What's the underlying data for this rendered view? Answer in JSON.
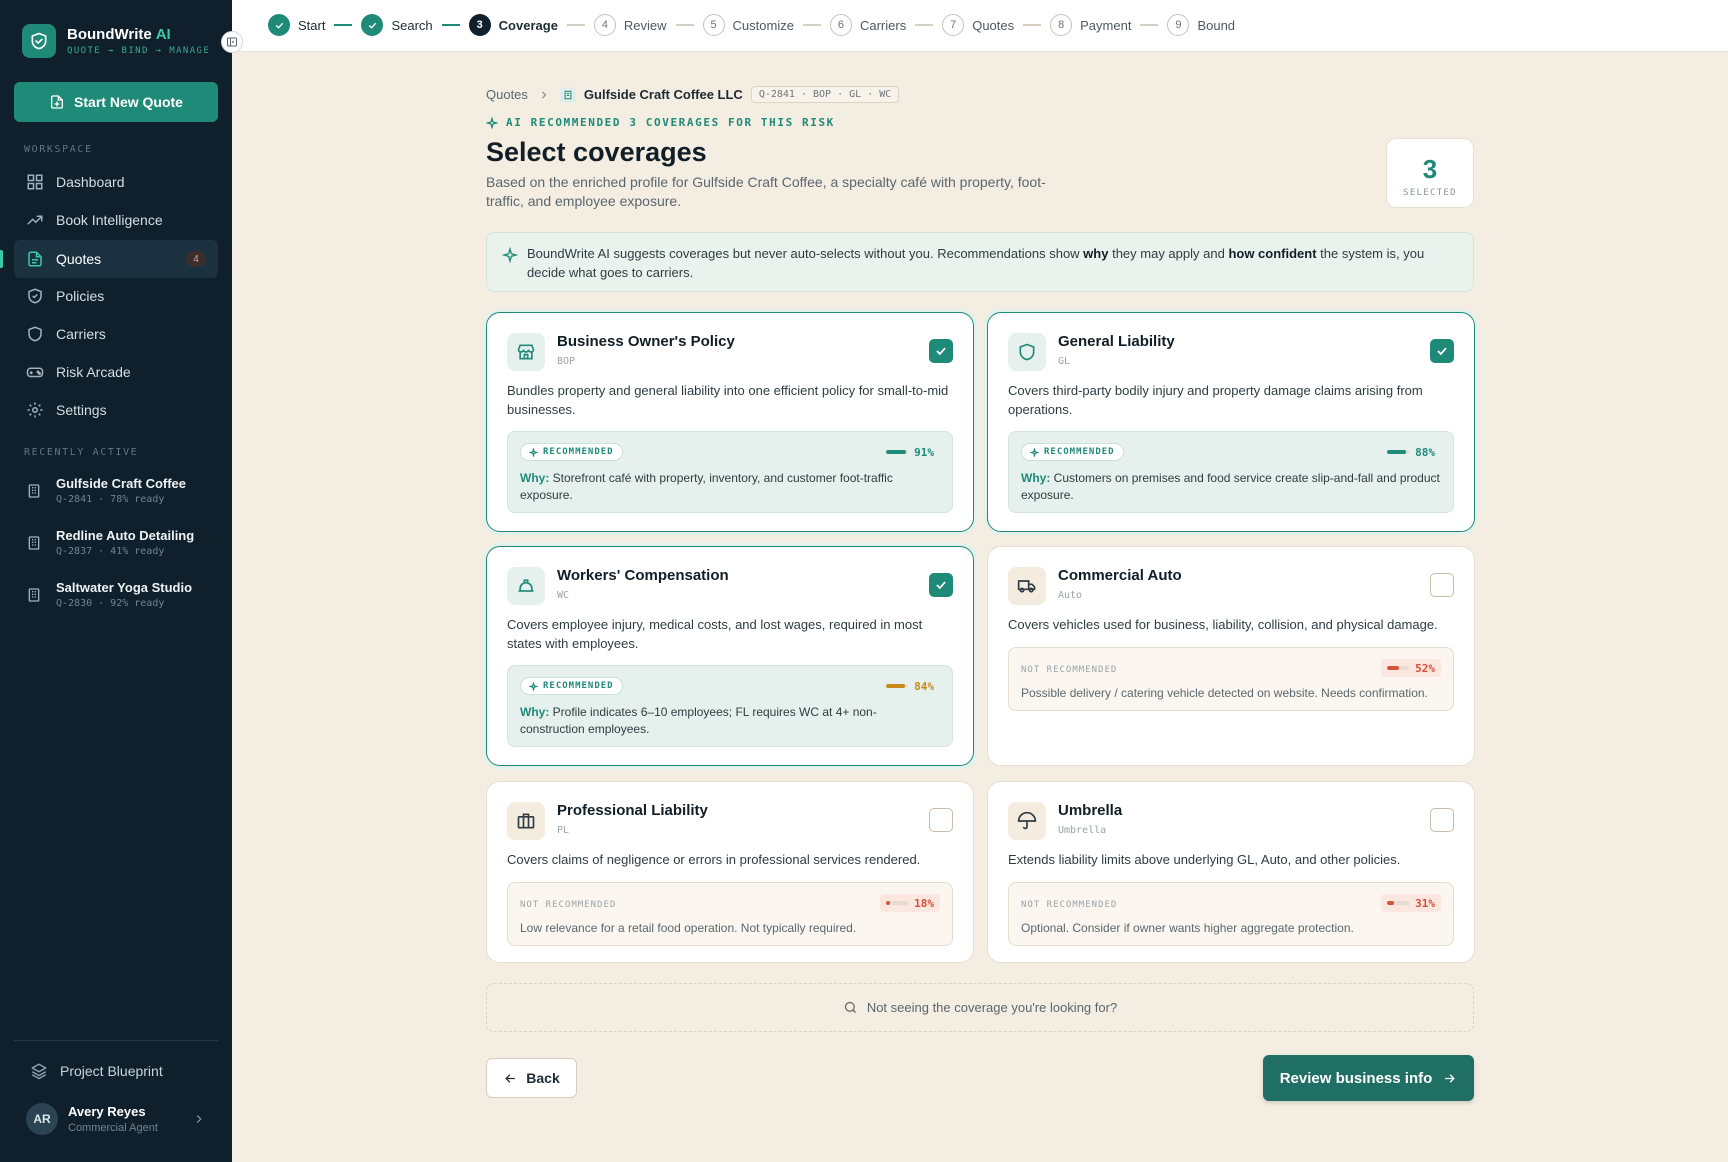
{
  "sidebar": {
    "brand_name": "BoundWrite",
    "brand_accent": "AI",
    "brand_tagline": "QUOTE → BIND → MANAGE",
    "new_quote_label": "Start New Quote",
    "workspace_label": "WORKSPACE",
    "nav": [
      {
        "label": "Dashboard",
        "icon": "grid-icon"
      },
      {
        "label": "Book Intelligence",
        "icon": "trend-icon"
      },
      {
        "label": "Quotes",
        "icon": "document-icon",
        "badge": "4"
      },
      {
        "label": "Policies",
        "icon": "shield-icon"
      },
      {
        "label": "Carriers",
        "icon": "shield-icon"
      },
      {
        "label": "Risk Arcade",
        "icon": "gamepad-icon"
      },
      {
        "label": "Settings",
        "icon": "gear-icon"
      }
    ],
    "recent_label": "RECENTLY ACTIVE",
    "recent": [
      {
        "name": "Gulfside Craft Coffee",
        "meta": "Q-2841 · 78% ready"
      },
      {
        "name": "Redline Auto Detailing",
        "meta": "Q-2837 · 41% ready"
      },
      {
        "name": "Saltwater Yoga Studio",
        "meta": "Q-2830 · 92% ready"
      }
    ],
    "blueprint_label": "Project Blueprint",
    "user": {
      "initials": "AR",
      "name": "Avery Reyes",
      "role": "Commercial Agent"
    }
  },
  "stepper": [
    {
      "num": "1",
      "label": "Start",
      "state": "done"
    },
    {
      "num": "2",
      "label": "Search",
      "state": "done"
    },
    {
      "num": "3",
      "label": "Coverage",
      "state": "current"
    },
    {
      "num": "4",
      "label": "Review",
      "state": "todo"
    },
    {
      "num": "5",
      "label": "Customize",
      "state": "todo"
    },
    {
      "num": "6",
      "label": "Carriers",
      "state": "todo"
    },
    {
      "num": "7",
      "label": "Quotes",
      "state": "todo"
    },
    {
      "num": "8",
      "label": "Payment",
      "state": "todo"
    },
    {
      "num": "9",
      "label": "Bound",
      "state": "todo"
    }
  ],
  "breadcrumb": {
    "root": "Quotes",
    "company": "Gulfside Craft Coffee LLC",
    "tag": "Q-2841 · BOP · GL · WC"
  },
  "ai_recommendation": "AI RECOMMENDED 3 COVERAGES FOR THIS RISK",
  "page": {
    "title": "Select coverages",
    "subtitle": "Based on the enriched profile for Gulfside Craft Coffee, a specialty café with property, foot-traffic, and employee exposure."
  },
  "selected_count": {
    "value": "3",
    "label": "SELECTED"
  },
  "banner": {
    "part1": "BoundWrite AI suggests coverages but never auto-selects without you. Recommendations show ",
    "bold1": "why",
    "part2": " they may apply and ",
    "bold2": "how confident",
    "part3": " the system is, you decide what goes to carriers."
  },
  "cards": [
    {
      "title": "Business Owner's Policy",
      "code": "BOP",
      "icon": "storefront-icon",
      "selected": true,
      "desc": "Bundles property and general liability into one efficient policy for small-to-mid businesses.",
      "status": "RECOMMENDED",
      "recommended": true,
      "confidence": "91%",
      "confidence_value": 0.91,
      "level": "green",
      "why_label": "Why:",
      "why": "Storefront café with property, inventory, and customer foot-traffic exposure."
    },
    {
      "title": "General Liability",
      "code": "GL",
      "icon": "shield-icon",
      "selected": true,
      "desc": "Covers third-party bodily injury and property damage claims arising from operations.",
      "status": "RECOMMENDED",
      "recommended": true,
      "confidence": "88%",
      "confidence_value": 0.88,
      "level": "green",
      "why_label": "Why:",
      "why": "Customers on premises and food service create slip-and-fall and product exposure."
    },
    {
      "title": "Workers' Compensation",
      "code": "WC",
      "icon": "hard-hat-icon",
      "selected": true,
      "desc": "Covers employee injury, medical costs, and lost wages, required in most states with employees.",
      "status": "RECOMMENDED",
      "recommended": true,
      "confidence": "84%",
      "confidence_value": 0.84,
      "level": "orange",
      "why_label": "Why:",
      "why": "Profile indicates 6–10 employees; FL requires WC at 4+ non-construction employees."
    },
    {
      "title": "Commercial Auto",
      "code": "Auto",
      "icon": "truck-icon",
      "selected": false,
      "desc": "Covers vehicles used for business, liability, collision, and physical damage.",
      "status": "NOT RECOMMENDED",
      "recommended": false,
      "confidence": "52%",
      "confidence_value": 0.52,
      "level": "red",
      "why": "Possible delivery / catering vehicle detected on website. Needs confirmation."
    },
    {
      "title": "Professional Liability",
      "code": "PL",
      "icon": "briefcase-icon",
      "selected": false,
      "desc": "Covers claims of negligence or errors in professional services rendered.",
      "status": "NOT RECOMMENDED",
      "recommended": false,
      "confidence": "18%",
      "confidence_value": 0.18,
      "level": "red",
      "why": "Low relevance for a retail food operation. Not typically required."
    },
    {
      "title": "Umbrella",
      "code": "Umbrella",
      "icon": "umbrella-icon",
      "selected": false,
      "desc": "Extends liability limits above underlying GL, Auto, and other policies.",
      "status": "NOT RECOMMENDED",
      "recommended": false,
      "confidence": "31%",
      "confidence_value": 0.31,
      "level": "red",
      "why": "Optional. Consider if owner wants higher aggregate protection."
    }
  ],
  "missing_prompt": "Not seeing the coverage you're looking for?",
  "buttons": {
    "back": "Back",
    "next": "Review business info"
  },
  "colors": {
    "accent": "#1f8a78",
    "sidebar": "#0f1f2c",
    "background": "#f4ede2",
    "warning": "#c8891a",
    "danger": "#d4523a"
  }
}
